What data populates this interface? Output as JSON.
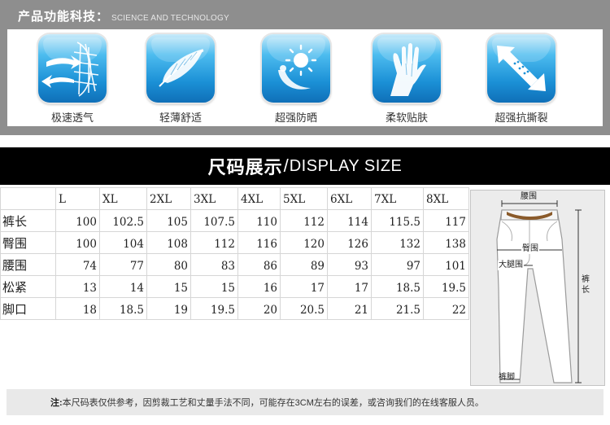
{
  "tech": {
    "title": "产品功能科技：",
    "subtitle": "SCIENCE AND TECHNOLOGY",
    "features": [
      {
        "label": "极速透气",
        "icon": "breathable-mesh-icon"
      },
      {
        "label": "轻薄舒适",
        "icon": "feather-icon"
      },
      {
        "label": "超强防晒",
        "icon": "sun-protection-icon"
      },
      {
        "label": "柔软贴肤",
        "icon": "soft-hands-icon"
      },
      {
        "label": "超强抗撕裂",
        "icon": "tear-resistant-icon"
      }
    ]
  },
  "size_banner": {
    "zh": "尺码展示",
    "sep": "/",
    "en": "DISPLAY SIZE"
  },
  "size_table": {
    "columns": [
      "L",
      "XL",
      "2XL",
      "3XL",
      "4XL",
      "5XL",
      "6XL",
      "7XL",
      "8XL"
    ],
    "rows": [
      {
        "label": "裤长",
        "values": [
          "100",
          "102.5",
          "105",
          "107.5",
          "110",
          "112",
          "114",
          "115.5",
          "117"
        ]
      },
      {
        "label": "臀围",
        "values": [
          "100",
          "104",
          "108",
          "112",
          "116",
          "120",
          "126",
          "132",
          "138"
        ]
      },
      {
        "label": "腰围",
        "values": [
          "74",
          "77",
          "80",
          "83",
          "86",
          "89",
          "93",
          "97",
          "101"
        ]
      },
      {
        "label": "松紧",
        "values": [
          "13",
          "14",
          "15",
          "15",
          "16",
          "17",
          "17",
          "18.5",
          "19.5"
        ]
      },
      {
        "label": "脚口",
        "values": [
          "18",
          "18.5",
          "19",
          "19.5",
          "20",
          "20.5",
          "21",
          "21.5",
          "22"
        ]
      }
    ]
  },
  "diagram": {
    "waist": "腰围",
    "hip": "臀围",
    "thigh": "大腿围",
    "length_1": "裤",
    "length_2": "长",
    "hem": "裤脚"
  },
  "note": {
    "label": "注:",
    "text": "本尺码表仅供参考，因剪裁工艺和丈量手法不同，可能存在3CM左右的误差，或咨询我们的在线客服人员。"
  }
}
